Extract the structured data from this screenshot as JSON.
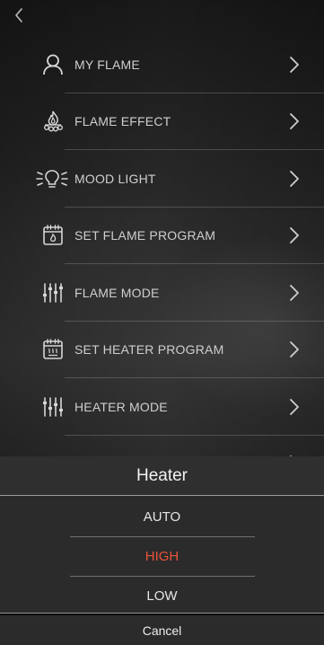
{
  "menu": {
    "items": [
      {
        "label": "MY FLAME",
        "icon": "person-icon"
      },
      {
        "label": "FLAME EFFECT",
        "icon": "flame-effect-icon"
      },
      {
        "label": "MOOD LIGHT",
        "icon": "mood-light-bulb-icon"
      },
      {
        "label": "SET FLAME PROGRAM",
        "icon": "flame-calendar-icon"
      },
      {
        "label": "FLAME MODE",
        "icon": "flame-sliders-icon"
      },
      {
        "label": "SET HEATER PROGRAM",
        "icon": "heater-calendar-icon"
      },
      {
        "label": "HEATER MODE",
        "icon": "heater-sliders-icon"
      }
    ]
  },
  "sheet": {
    "title": "Heater",
    "options": [
      {
        "label": "AUTO",
        "selected": false
      },
      {
        "label": "HIGH",
        "selected": true
      },
      {
        "label": "LOW",
        "selected": false
      }
    ],
    "cancel_label": "Cancel"
  },
  "colors": {
    "selected": "#e8553a",
    "menu_text": "#cfcfcf"
  }
}
